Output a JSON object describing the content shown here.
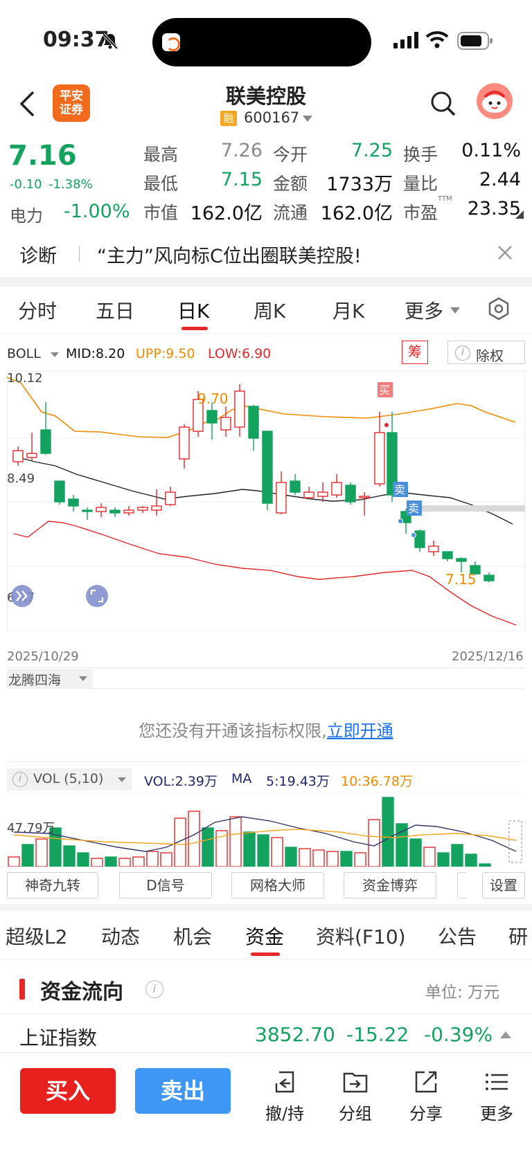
{
  "status": {
    "time": "09:37"
  },
  "header": {
    "broker_logo": "平安\n证券",
    "title": "联美控股",
    "tag": "融",
    "code": "600167"
  },
  "quote": {
    "price": "7.16",
    "change": "-0.10",
    "change_pct": "-1.38%",
    "sector_label": "电力",
    "sector_pct": "-1.00%",
    "items": [
      {
        "label": "最高",
        "value": "7.26"
      },
      {
        "label": "今开",
        "value": "7.25"
      },
      {
        "label": "换手",
        "value": "0.11%"
      },
      {
        "label": "最低",
        "value": "7.15"
      },
      {
        "label": "金额",
        "value": "1733万"
      },
      {
        "label": "量比",
        "value": "2.44"
      },
      {
        "label": "市值",
        "value": "162.0亿"
      },
      {
        "label": "流通",
        "value": "162.0亿"
      },
      {
        "label": "市盈",
        "value": "23.35"
      }
    ],
    "ttm": "TTM"
  },
  "diagnosis": {
    "label": "诊断",
    "text": "“主力”风向标C位出圈联美控股!"
  },
  "period_tabs": [
    "分时",
    "五日",
    "日K",
    "周K",
    "月K",
    "更多"
  ],
  "active_period": "日K",
  "boll": {
    "name": "BOLL",
    "mid": "MID:8.20",
    "upp": "UPP:9.50",
    "low": "LOW:6.90",
    "chip": "筹",
    "exright": "除权",
    "y_top": "10.12",
    "y_mid": "8.49",
    "y_bottom": "6.87",
    "date_start": "2025/10/29",
    "date_end": "2025/12/16",
    "high_mark": "9.70",
    "last_mark": "7.15",
    "buy_tag": "买",
    "sell_tag": "卖",
    "colors": {
      "up": "#e5282a",
      "down": "#14a35e",
      "upper": "#f08a00",
      "mid": "#222222",
      "lower": "#e5282a"
    }
  },
  "indicator": {
    "name": "龙腾四海",
    "notice": "您还没有开通该指标权限,",
    "notice_link": "立即开通"
  },
  "volume": {
    "name": "VOL (5,10)",
    "vol": "VOL:2.39万",
    "ma_label": "MA",
    "ma5": "5:19.43万",
    "ma10": "10:36.78万",
    "y_label": "47.79万"
  },
  "tool_buttons": [
    "神奇九转",
    "D信号",
    "网格大师",
    "资金博弈",
    "设置"
  ],
  "section_tabs": [
    "超级L2",
    "动态",
    "机会",
    "资金",
    "资料(F10)",
    "公告",
    "研"
  ],
  "active_section": "资金",
  "fund_flow": {
    "title": "资金流向",
    "unit": "单位: 万元",
    "index_name": "上证指数",
    "index_value": "3852.70",
    "index_change": "-15.22",
    "index_pct": "-0.39%"
  },
  "bottom": {
    "buy": "买入",
    "sell": "卖出",
    "items": [
      "撤/持",
      "分组",
      "分享",
      "更多"
    ]
  }
}
